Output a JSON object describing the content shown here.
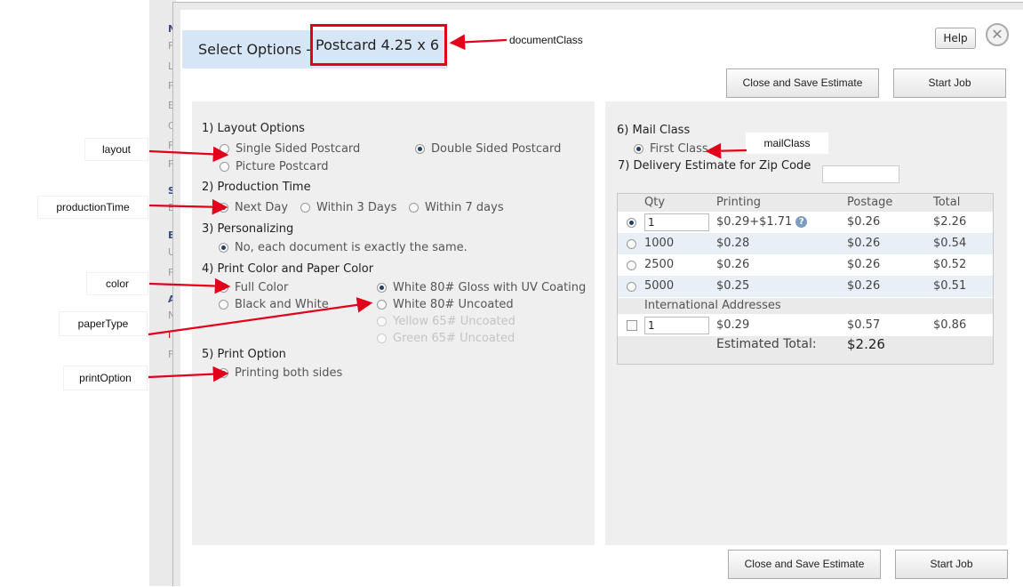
{
  "dialog": {
    "title": "Select Options - ",
    "document": "Postcard 4.25 x 6",
    "help_label": "Help",
    "close_glyph": "✕",
    "close_icon": "close-icon",
    "buttons": {
      "save": "Close and Save Estimate",
      "start": "Start Job"
    }
  },
  "left": {
    "layout": {
      "heading": "1) Layout Options",
      "options": [
        {
          "label": "Single Sided Postcard",
          "selected": false
        },
        {
          "label": "Double Sided Postcard",
          "selected": true
        },
        {
          "label": "Picture Postcard",
          "selected": false
        }
      ]
    },
    "production": {
      "heading": "2) Production Time",
      "options": [
        {
          "label": "Next Day",
          "selected": true
        },
        {
          "label": "Within 3 Days",
          "selected": false
        },
        {
          "label": "Within 7 days",
          "selected": false
        }
      ]
    },
    "personalizing": {
      "heading": "3) Personalizing",
      "options": [
        {
          "label": "No, each document is exactly the same.",
          "selected": true
        }
      ]
    },
    "color": {
      "heading": "4) Print Color and Paper Color",
      "color_options": [
        {
          "label": "Full Color",
          "selected": true
        },
        {
          "label": "Black and White",
          "selected": false
        }
      ],
      "paper_options": [
        {
          "label": "White 80# Gloss with UV Coating",
          "selected": true,
          "disabled": false
        },
        {
          "label": "White 80# Uncoated",
          "selected": false,
          "disabled": false
        },
        {
          "label": "Yellow 65# Uncoated",
          "selected": false,
          "disabled": true
        },
        {
          "label": "Green 65# Uncoated",
          "selected": false,
          "disabled": true
        }
      ]
    },
    "print_option": {
      "heading": "5) Print Option",
      "options": [
        {
          "label": "Printing both sides",
          "selected": true
        }
      ]
    }
  },
  "right": {
    "mail_class": {
      "heading": "6) Mail Class",
      "options": [
        {
          "label": "First Class",
          "selected": true
        }
      ]
    },
    "delivery": {
      "label": "7) Delivery Estimate for Zip Code",
      "zip_value": ""
    },
    "table": {
      "headers": {
        "qty": "Qty",
        "printing": "Printing",
        "postage": "Postage",
        "total": "Total"
      },
      "rows": [
        {
          "qty": "1",
          "printing": "$0.29+$1.71",
          "postage": "$0.26",
          "total": "$2.26",
          "selected": true,
          "editable": true
        },
        {
          "qty": "1000",
          "printing": "$0.28",
          "postage": "$0.26",
          "total": "$0.54",
          "selected": false,
          "editable": false
        },
        {
          "qty": "2500",
          "printing": "$0.26",
          "postage": "$0.26",
          "total": "$0.52",
          "selected": false,
          "editable": false
        },
        {
          "qty": "5000",
          "printing": "$0.25",
          "postage": "$0.26",
          "total": "$0.51",
          "selected": false,
          "editable": false
        }
      ],
      "help_glyph": "?",
      "help_icon": "question-circle-icon",
      "international": {
        "label": "International Addresses",
        "qty": "1",
        "printing": "$0.29",
        "postage": "$0.57",
        "total": "$0.86",
        "checked": false
      },
      "estimated_label": "Estimated Total:",
      "estimated_value": "$2.26"
    }
  },
  "annotations": {
    "documentClass": "documentClass",
    "layout": "layout",
    "productionTime": "productionTime",
    "color": "color",
    "paperType": "paperType",
    "printOption": "printOption",
    "mailClass": "mailClass",
    "accent": "#e2001a"
  },
  "background_letters": [
    "N",
    "F",
    "L",
    "F",
    "E",
    "C",
    "F",
    "F",
    "S",
    "E",
    "E",
    "U",
    "F",
    "A",
    "N",
    "I",
    "F"
  ]
}
